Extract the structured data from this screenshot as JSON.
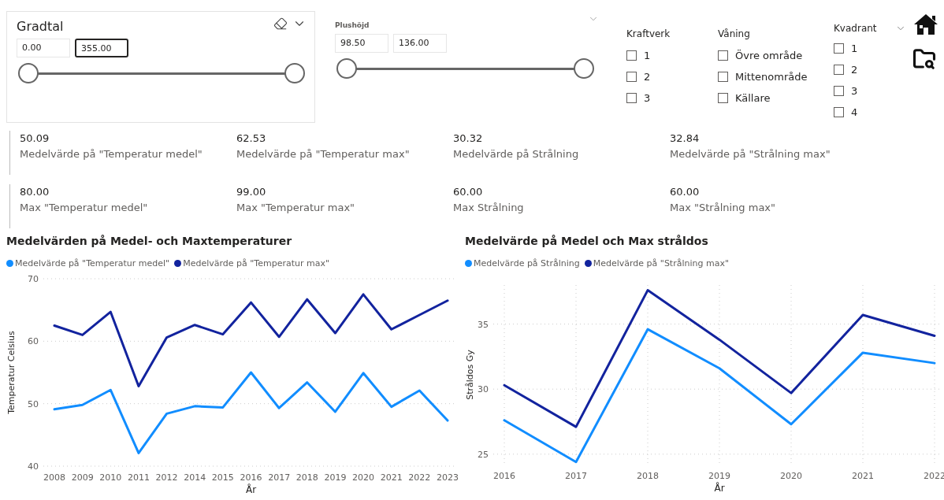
{
  "range_sliders": [
    {
      "kind": "card",
      "title": "Gradtal",
      "clear_icon": true,
      "fields": [
        {
          "value": "0.00",
          "focused": false
        },
        {
          "value": "355.00",
          "focused": true
        }
      ],
      "thumbs": [
        {
          "level": 0
        },
        {
          "level": 1
        }
      ]
    },
    {
      "kind": "plain",
      "title": "Plushöjd",
      "fields": [
        {
          "value": "98.50",
          "focused": false
        },
        {
          "value": "136.00",
          "focused": false
        }
      ],
      "thumbs": [
        {
          "level": 0
        },
        {
          "level": 1
        }
      ]
    }
  ],
  "filters": [
    {
      "title": "Kraftverk",
      "items": [
        {
          "label": "1",
          "checked": false
        },
        {
          "label": "2",
          "checked": false
        },
        {
          "label": "3",
          "checked": false
        }
      ]
    },
    {
      "title": "Våning",
      "items": [
        {
          "label": "Övre område",
          "checked": false
        },
        {
          "label": "Mittenområde",
          "checked": false
        },
        {
          "label": "Källare",
          "checked": false
        }
      ]
    },
    {
      "title": "Kvadrant",
      "dropdown": true,
      "items": [
        {
          "label": "1",
          "checked": false
        },
        {
          "label": "2",
          "checked": false
        },
        {
          "label": "3",
          "checked": false
        },
        {
          "label": "4",
          "checked": false
        }
      ]
    }
  ],
  "cards": [
    {
      "value": "50.09",
      "label": "Medelvärde på \"Temperatur medel\""
    },
    {
      "value": "62.53",
      "label": "Medelvärde på \"Temperatur max\""
    },
    {
      "value": "30.32",
      "label": "Medelvärde på Strålning"
    },
    {
      "value": "32.84",
      "label": "Medelvärde på \"Strålning max\""
    },
    {
      "value": "80.00",
      "label": "Max \"Temperatur medel\""
    },
    {
      "value": "99.00",
      "label": "Max \"Temperatur max\""
    },
    {
      "value": "60.00",
      "label": "Max Strålning"
    },
    {
      "value": "60.00",
      "label": "Max \"Strålning max\""
    }
  ],
  "charts": [
    {
      "chart_data": {
        "type": "line",
        "title": "Medelvärden på Medel- och Maxtemperaturer",
        "xlabel": "År",
        "ylabel": "Temperatur Celsius",
        "grid": true,
        "categories": [
          "2008",
          "2009",
          "2010",
          "2011",
          "2012",
          "2014",
          "2015",
          "2016",
          "2017",
          "2018",
          "2019",
          "2020",
          "2021",
          "2022",
          "2023"
        ],
        "ylim": [
          40,
          70
        ],
        "yticks": [
          40,
          50,
          60,
          70
        ],
        "series": [
          {
            "name": "Medelvärde på \"Temperatur medel\"",
            "color": "#118dff",
            "values": [
              49.1,
              49.8,
              52.2,
              42.1,
              48.4,
              49.6,
              49.4,
              55.0,
              49.3,
              53.4,
              48.7,
              54.9,
              49.5,
              52.1,
              47.3
            ]
          },
          {
            "name": "Medelvärde på \"Temperatur max\"",
            "color": "#12239e",
            "values": [
              62.5,
              61.0,
              64.7,
              52.8,
              60.6,
              62.6,
              61.1,
              66.2,
              60.7,
              66.7,
              61.3,
              67.5,
              61.9,
              64.2,
              66.5
            ]
          }
        ]
      }
    },
    {
      "vertical_grid": true,
      "chart_data": {
        "type": "line",
        "title": "Medelvärde på Medel och Max stråldos",
        "xlabel": "År",
        "ylabel": "Stråldos Gy",
        "grid": true,
        "ylim": [
          24.2,
          38
        ],
        "categories": [
          "2016",
          "2017",
          "2018",
          "2019",
          "2020",
          "2021",
          "2022"
        ],
        "yticks": [
          25,
          30,
          35
        ],
        "series": [
          {
            "name": "Medelvärde på Strålning",
            "color": "#118dff",
            "values": [
              27.6,
              24.4,
              34.6,
              31.6,
              27.3,
              32.8,
              32.0
            ]
          },
          {
            "name": "Medelvärde på \"Strålning max\"",
            "color": "#12239e",
            "values": [
              30.3,
              27.1,
              37.6,
              33.8,
              29.7,
              35.7,
              34.1
            ]
          }
        ]
      }
    }
  ]
}
